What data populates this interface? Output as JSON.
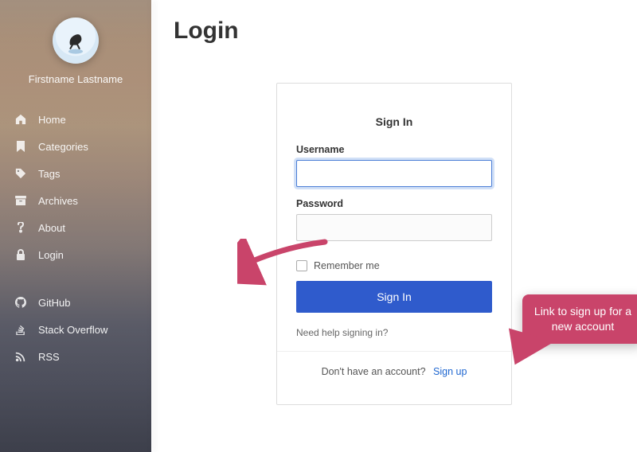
{
  "sidebar": {
    "username": "Firstname Lastname",
    "nav": [
      {
        "icon": "home-icon",
        "label": "Home"
      },
      {
        "icon": "bookmark-icon",
        "label": "Categories"
      },
      {
        "icon": "tag-icon",
        "label": "Tags"
      },
      {
        "icon": "archive-icon",
        "label": "Archives"
      },
      {
        "icon": "question-icon",
        "label": "About"
      },
      {
        "icon": "lock-icon",
        "label": "Login"
      }
    ],
    "external": [
      {
        "icon": "github-icon",
        "label": "GitHub"
      },
      {
        "icon": "stackoverflow-icon",
        "label": "Stack Overflow"
      },
      {
        "icon": "rss-icon",
        "label": "RSS"
      }
    ]
  },
  "page": {
    "title": "Login"
  },
  "form": {
    "heading": "Sign In",
    "username_label": "Username",
    "password_label": "Password",
    "remember_label": "Remember me",
    "submit_label": "Sign In",
    "help_label": "Need help signing in?",
    "signup_prompt": "Don't have an account?",
    "signup_link": "Sign up"
  },
  "annotations": {
    "callout_text": "Link to sign up for a new account"
  },
  "colors": {
    "accent": "#2f5bcc",
    "annotation": "#c9446a"
  }
}
